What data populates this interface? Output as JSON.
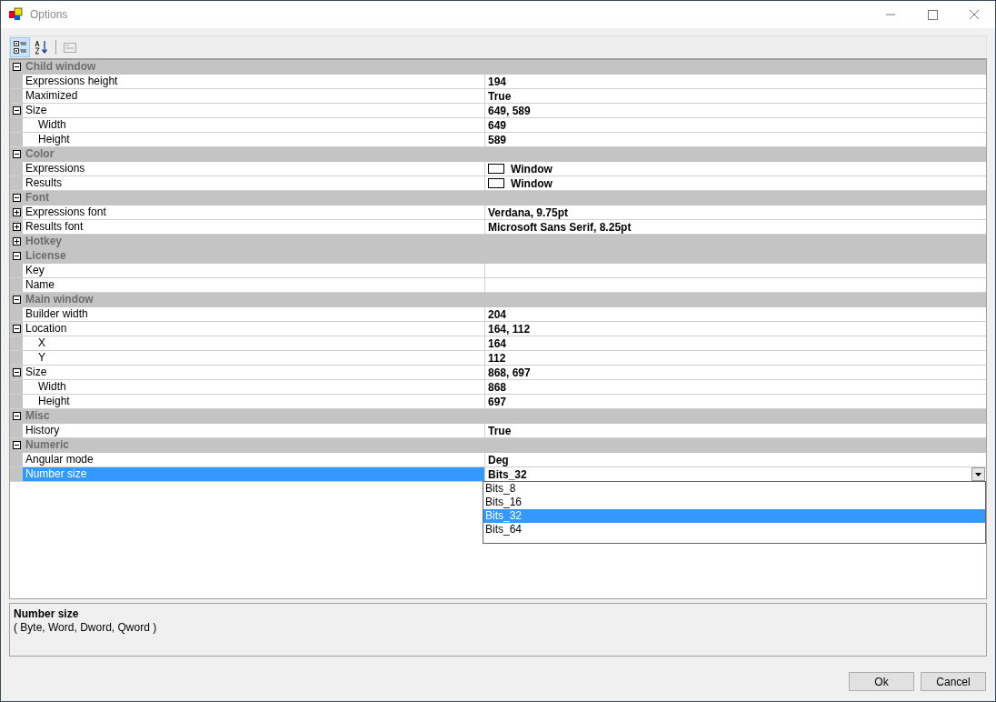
{
  "window": {
    "title": "Options"
  },
  "toolbar": [
    {
      "kind": "categorized",
      "selected": true
    },
    {
      "kind": "alphabetical",
      "selected": false
    },
    {
      "kind": "pages",
      "selected": false
    }
  ],
  "categories": [
    {
      "name": "Child window",
      "expanded": true,
      "properties": [
        {
          "name": "Expressions height",
          "value": "194",
          "kind": "text",
          "selected": false
        },
        {
          "name": "Maximized",
          "value": "True",
          "kind": "text",
          "selected": false
        },
        {
          "name": "Size",
          "value": "649, 589",
          "kind": "text",
          "selected": false,
          "expanded": true,
          "children": [
            {
              "name": "Width",
              "value": "649",
              "kind": "text",
              "selected": false
            },
            {
              "name": "Height",
              "value": "589",
              "kind": "text",
              "selected": false
            }
          ]
        }
      ]
    },
    {
      "name": "Color",
      "expanded": true,
      "properties": [
        {
          "name": "Expressions",
          "value": "Window",
          "kind": "color",
          "color": "#ffffff",
          "selected": false
        },
        {
          "name": "Results",
          "value": "Window",
          "kind": "color",
          "color": "#ffffff",
          "selected": false
        }
      ]
    },
    {
      "name": "Font",
      "expanded": true,
      "properties": [
        {
          "name": "Expressions font",
          "value": "Verdana, 9.75pt",
          "kind": "text",
          "selected": false,
          "expanded": false
        },
        {
          "name": "Results font",
          "value": "Microsoft Sans Serif, 8.25pt",
          "kind": "text",
          "selected": false,
          "expanded": false
        }
      ]
    },
    {
      "name": "Hotkey",
      "expanded": false
    },
    {
      "name": "License",
      "expanded": true,
      "properties": [
        {
          "name": "Key",
          "selected": false
        },
        {
          "name": "Name",
          "selected": false
        }
      ]
    },
    {
      "name": "Main window",
      "expanded": true,
      "properties": [
        {
          "name": "Builder width",
          "value": "204",
          "kind": "text",
          "selected": false
        },
        {
          "name": "Location",
          "value": "164, 112",
          "kind": "text",
          "selected": false,
          "expanded": true,
          "children": [
            {
              "name": "X",
              "value": "164",
              "kind": "text",
              "selected": false
            },
            {
              "name": "Y",
              "value": "112",
              "kind": "text",
              "selected": false
            }
          ]
        },
        {
          "name": "Size",
          "value": "868, 697",
          "kind": "text",
          "selected": false,
          "expanded": true,
          "children": [
            {
              "name": "Width",
              "value": "868",
              "kind": "text",
              "selected": false
            },
            {
              "name": "Height",
              "value": "697",
              "kind": "text",
              "selected": false
            }
          ]
        }
      ]
    },
    {
      "name": "Misc",
      "expanded": true,
      "properties": [
        {
          "name": "History",
          "value": "True",
          "kind": "text",
          "selected": false
        }
      ]
    },
    {
      "name": "Numeric",
      "expanded": true,
      "properties": [
        {
          "name": "Angular mode",
          "value": "Deg",
          "kind": "text",
          "selected": false
        },
        {
          "name": "Number size",
          "value": "Bits_32",
          "kind": "combo",
          "selected": true,
          "options": [
            {
              "label": "Bits_8",
              "selected": false
            },
            {
              "label": "Bits_16",
              "selected": false
            },
            {
              "label": "Bits_32",
              "selected": true
            },
            {
              "label": "Bits_64",
              "selected": false
            }
          ]
        }
      ]
    }
  ],
  "help": {
    "title": "Number size",
    "description": "( Byte, Word, Dword, Qword )"
  },
  "buttons": [
    "Ok",
    "Cancel"
  ]
}
